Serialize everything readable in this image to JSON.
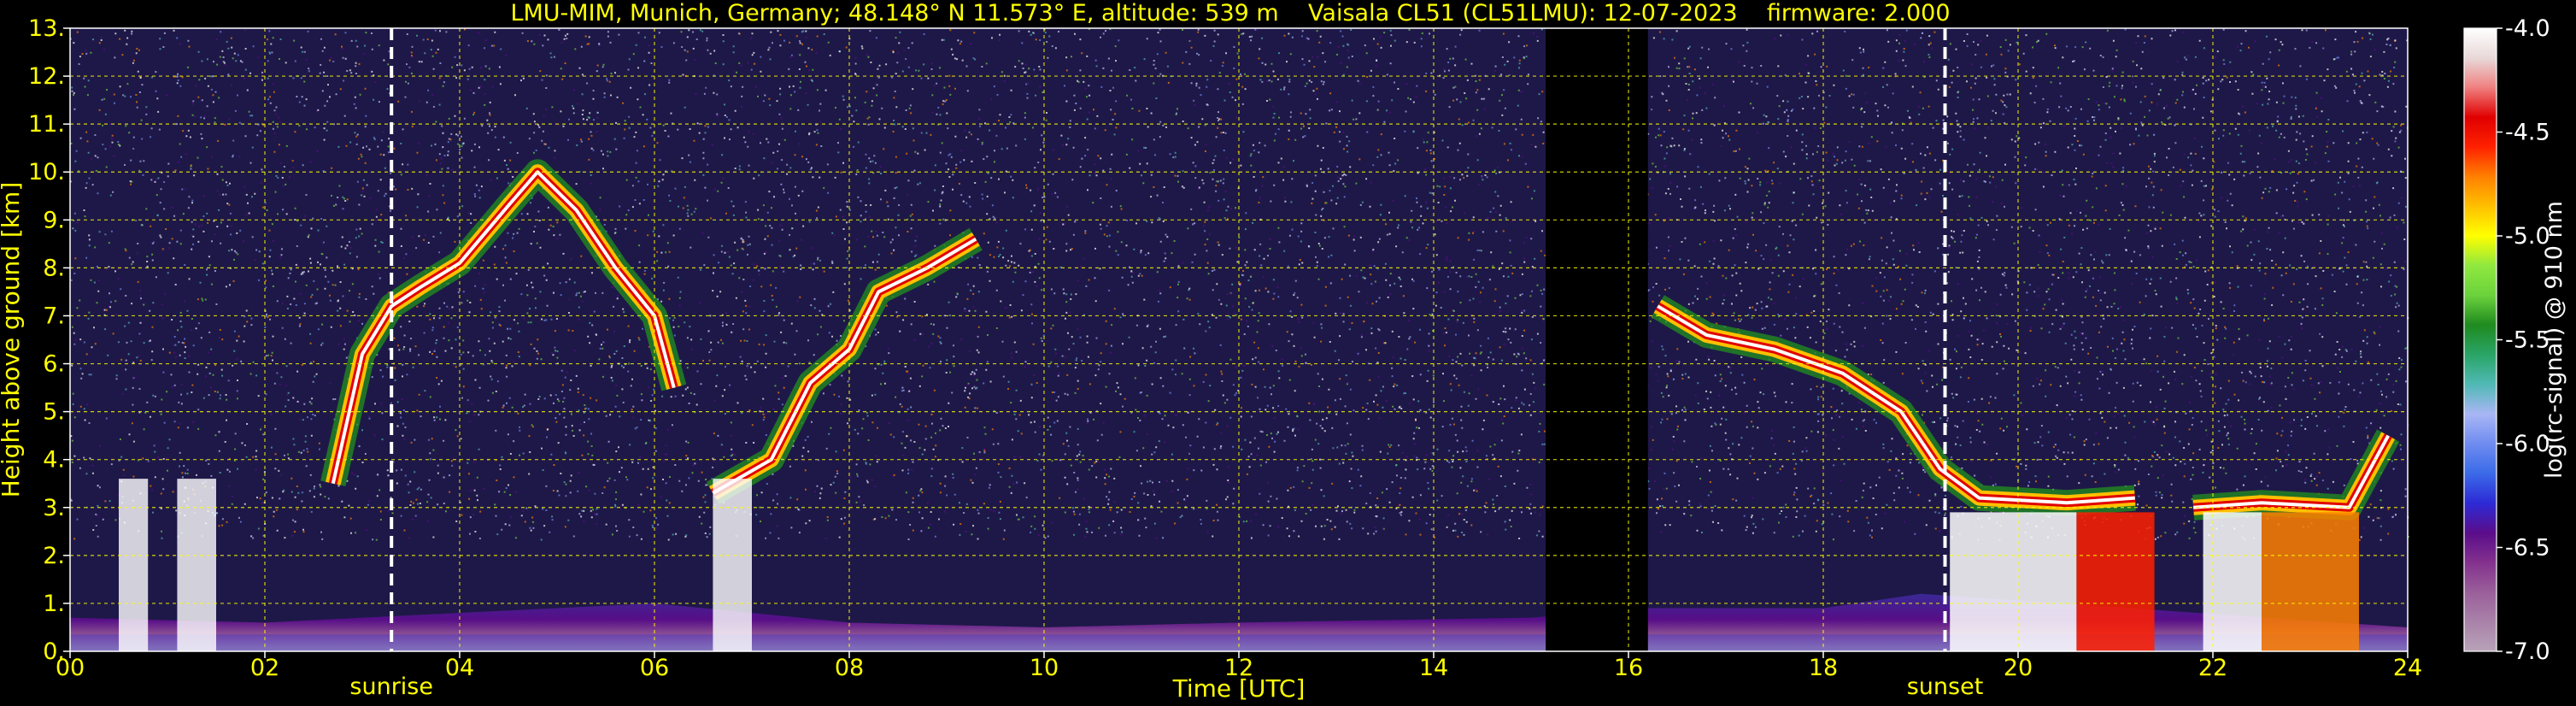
{
  "chart_data": {
    "type": "heatmap",
    "title": "LMU-MIM, Munich, Germany; 48.148° N 11.573° E, altitude: 539 m    Vaisala CL51 (CL51LMU): 12-07-2023    firmware: 2.000",
    "xlabel": "Time [UTC]",
    "ylabel": "Height above ground [km]",
    "colorbar_label": "log(rc-signal) @ 910 nm",
    "xlim": [
      0,
      24
    ],
    "ylim": [
      0,
      13
    ],
    "xticks": [
      "00",
      "02",
      "04",
      "06",
      "08",
      "10",
      "12",
      "14",
      "16",
      "18",
      "20",
      "22",
      "24"
    ],
    "yticks": [
      "0.",
      "1.",
      "2.",
      "3.",
      "4.",
      "5.",
      "6.",
      "7.",
      "8.",
      "9.",
      "10.",
      "11.",
      "12.",
      "13."
    ],
    "colorbar_range": [
      -7.0,
      -4.0
    ],
    "colorbar_ticks": [
      "-4.0",
      "-4.5",
      "-5.0",
      "-5.5",
      "-6.0",
      "-6.5",
      "-7.0"
    ],
    "grid": true,
    "markers": [
      {
        "label": "sunrise",
        "time": 3.3
      },
      {
        "label": "sunset",
        "time": 19.25
      }
    ],
    "colormap": [
      "#b8a3b8",
      "#a982a9",
      "#9a5f9a",
      "#83318e",
      "#5a0d8a",
      "#2d2ad6",
      "#3b6be8",
      "#6f8cf0",
      "#a9b6f5",
      "#4fb9b4",
      "#2aa567",
      "#1f8a1f",
      "#6bd23c",
      "#8fe83f",
      "#ffff00",
      "#ffc000",
      "#ff8000",
      "#ff2000",
      "#e00000",
      "#f08080",
      "#e8d8d8",
      "#ffffff"
    ],
    "features": [
      {
        "name": "boundary-layer",
        "points": [
          [
            0,
            0.7
          ],
          [
            2,
            0.6
          ],
          [
            4,
            0.8
          ],
          [
            6,
            1.0
          ],
          [
            8,
            0.6
          ],
          [
            10,
            0.5
          ],
          [
            12,
            0.6
          ],
          [
            15,
            0.7
          ],
          [
            16.2,
            0.9
          ],
          [
            18,
            0.9
          ],
          [
            19,
            1.2
          ],
          [
            24,
            0.5
          ]
        ]
      },
      {
        "name": "cloud-layer-morning",
        "points": [
          [
            2.7,
            3.5
          ],
          [
            3.0,
            6.2
          ],
          [
            3.3,
            7.2
          ],
          [
            3.6,
            7.6
          ],
          [
            4.0,
            8.1
          ],
          [
            4.5,
            9.3
          ],
          [
            4.8,
            10.0
          ],
          [
            5.2,
            9.2
          ],
          [
            5.6,
            8.0
          ],
          [
            6.0,
            7.0
          ],
          [
            6.2,
            5.5
          ]
        ]
      },
      {
        "name": "cloud-layer-midday",
        "points": [
          [
            6.6,
            3.3
          ],
          [
            7.2,
            4.0
          ],
          [
            7.6,
            5.6
          ],
          [
            8.0,
            6.3
          ],
          [
            8.3,
            7.5
          ],
          [
            8.8,
            8.0
          ],
          [
            9.3,
            8.6
          ]
        ]
      },
      {
        "name": "cloud-layer-afternoon",
        "points": [
          [
            16.3,
            7.2
          ],
          [
            16.8,
            6.6
          ],
          [
            17.5,
            6.3
          ],
          [
            18.2,
            5.8
          ],
          [
            18.8,
            5.0
          ],
          [
            19.2,
            3.8
          ],
          [
            19.6,
            3.2
          ],
          [
            20.5,
            3.1
          ],
          [
            21.2,
            3.2
          ]
        ]
      },
      {
        "name": "low-cloud-evening",
        "points": [
          [
            21.8,
            3.0
          ],
          [
            22.5,
            3.1
          ],
          [
            23.4,
            3.0
          ],
          [
            23.8,
            4.5
          ]
        ]
      }
    ],
    "no_data_intervals": [
      [
        15.15,
        16.2
      ]
    ]
  }
}
